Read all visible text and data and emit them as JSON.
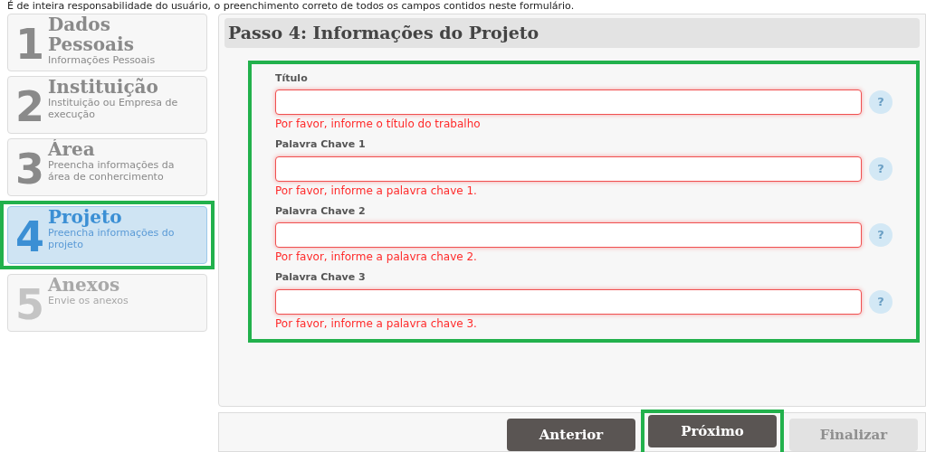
{
  "notice": "É de inteira responsabilidade do usuário, o preenchimento correto de todos os campos contidos neste formulário.",
  "steps": [
    {
      "number": "1",
      "title": "Dados Pessoais",
      "subtitle": "Informações Pessoais",
      "selected": false,
      "disabled": false,
      "highlighted": false
    },
    {
      "number": "2",
      "title": "Instituição",
      "subtitle": "Instituição ou Empresa de execução",
      "selected": false,
      "disabled": false,
      "highlighted": false
    },
    {
      "number": "3",
      "title": "Área",
      "subtitle": "Preencha informações da área de conhercimento",
      "selected": false,
      "disabled": false,
      "highlighted": false
    },
    {
      "number": "4",
      "title": "Projeto",
      "subtitle": "Preencha informações do projeto",
      "selected": true,
      "disabled": false,
      "highlighted": true
    },
    {
      "number": "5",
      "title": "Anexos",
      "subtitle": "Envie os anexos",
      "selected": false,
      "disabled": true,
      "highlighted": false
    }
  ],
  "panel": {
    "title": "Passo 4: Informações do Projeto",
    "highlighted": true
  },
  "fields": [
    {
      "label": "Título",
      "error": "Por favor, informe o título do trabalho",
      "invalid": true,
      "help": "?"
    },
    {
      "label": "Palavra Chave 1",
      "error": "Por favor, informe a palavra chave 1.",
      "invalid": true,
      "help": "?"
    },
    {
      "label": "Palavra Chave 2",
      "error": "Por favor, informe a palavra chave 2.",
      "invalid": true,
      "help": "?"
    },
    {
      "label": "Palavra Chave 3",
      "error": "Por favor, informe a palavra chave 3.",
      "invalid": true,
      "help": "?"
    }
  ],
  "buttons": [
    {
      "label": "Anterior",
      "disabled": false,
      "highlighted": false
    },
    {
      "label": "Próximo",
      "disabled": false,
      "highlighted": true
    },
    {
      "label": "Finalizar",
      "disabled": true,
      "highlighted": false
    }
  ]
}
